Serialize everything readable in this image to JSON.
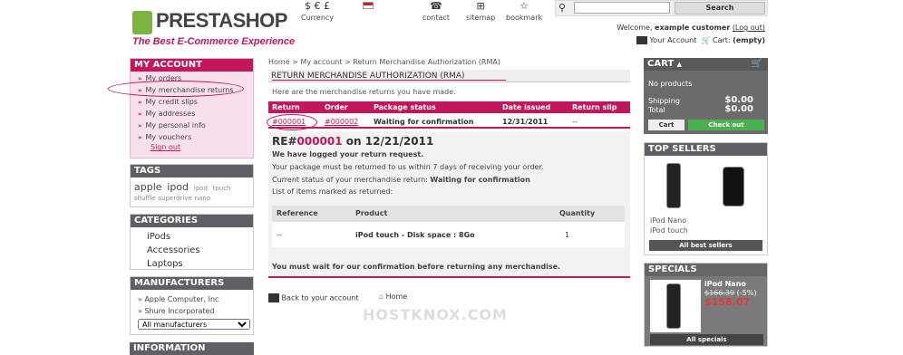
{
  "header": {
    "logo_name": "PRESTASHOP",
    "tagline": "The Best E-Commerce Experience",
    "currency_label": "Currency",
    "currency_symbols": "$ € £",
    "contact": "contact",
    "sitemap": "sitemap",
    "bookmark": "bookmark",
    "search_placeholder": "",
    "search_button": "Search",
    "welcome": "Welcome,",
    "customer_name": "example customer",
    "logout": "(Log out)",
    "your_account": "Your Account",
    "cart_label": "Cart:",
    "cart_status": "(empty)"
  },
  "left": {
    "account": {
      "title": "MY ACCOUNT",
      "items": [
        "My orders",
        "My merchandise returns",
        "My credit slips",
        "My addresses",
        "My personal info",
        "My vouchers"
      ],
      "signout": "Sign out"
    },
    "tags": {
      "title": "TAGS",
      "big": [
        "apple",
        "ipod"
      ],
      "small": [
        "Ipod",
        "touch",
        "shuffle",
        "superdrive",
        "nano"
      ]
    },
    "categories": {
      "title": "CATEGORIES",
      "items": [
        "iPods",
        "Accessories",
        "Laptops"
      ]
    },
    "manufacturers": {
      "title": "MANUFACTURERS",
      "items": [
        "Apple Computer, Inc",
        "Shure Incorporated"
      ],
      "select_value": "All manufacturers"
    },
    "information_title": "INFORMATION"
  },
  "main": {
    "breadcrumb": {
      "home": "Home",
      "sep": ">",
      "account": "My account",
      "current": "Return Merchandise Authorization (RMA)"
    },
    "title": "RETURN MERCHANDISE AUTHORIZATION (RMA)",
    "description": "Here are the merchandise returns you have made.",
    "table": {
      "headers": [
        "Return",
        "Order",
        "Package status",
        "Date issued",
        "Return slip"
      ],
      "row": [
        "#000001",
        "#000002",
        "Waiting for confirmation",
        "12/31/2011",
        "--"
      ]
    },
    "detail": {
      "heading_prefix": "RE#",
      "heading_number": "000001",
      "heading_suffix": "on 12/21/2011",
      "logged": "We have logged your return request.",
      "within": "Your package must be returned to us within 7 days of receiving your order.",
      "status_label": "Current status of your merchandise return:",
      "status_value": "Waiting for confirmation",
      "list_label": "List of items marked as returned:",
      "items_headers": [
        "Reference",
        "Product",
        "Quantity"
      ],
      "items_row": [
        "--",
        "iPod touch - Disk space : 8Go",
        "1"
      ],
      "wait_note": "You must wait for our confirmation before returning any merchandise."
    },
    "back_link": "Back to your account",
    "home_link": "Home",
    "watermark": "HOSTKNOX.COM"
  },
  "right": {
    "cart": {
      "title": "CART",
      "no_products": "No products",
      "shipping_label": "Shipping",
      "shipping_value": "$0.00",
      "total_label": "Total",
      "total_value": "$0.00",
      "cart_button": "Cart",
      "checkout_button": "Check out"
    },
    "top_sellers": {
      "title": "TOP SELLERS",
      "items": [
        "iPod Nano",
        "iPod touch"
      ],
      "all_button": "All best sellers"
    },
    "specials": {
      "title": "SPECIALS",
      "product": "iPod Nano",
      "old_price": "$166.39",
      "discount": "(-5%)",
      "new_price": "$158.07",
      "all_button": "All specials"
    }
  }
}
